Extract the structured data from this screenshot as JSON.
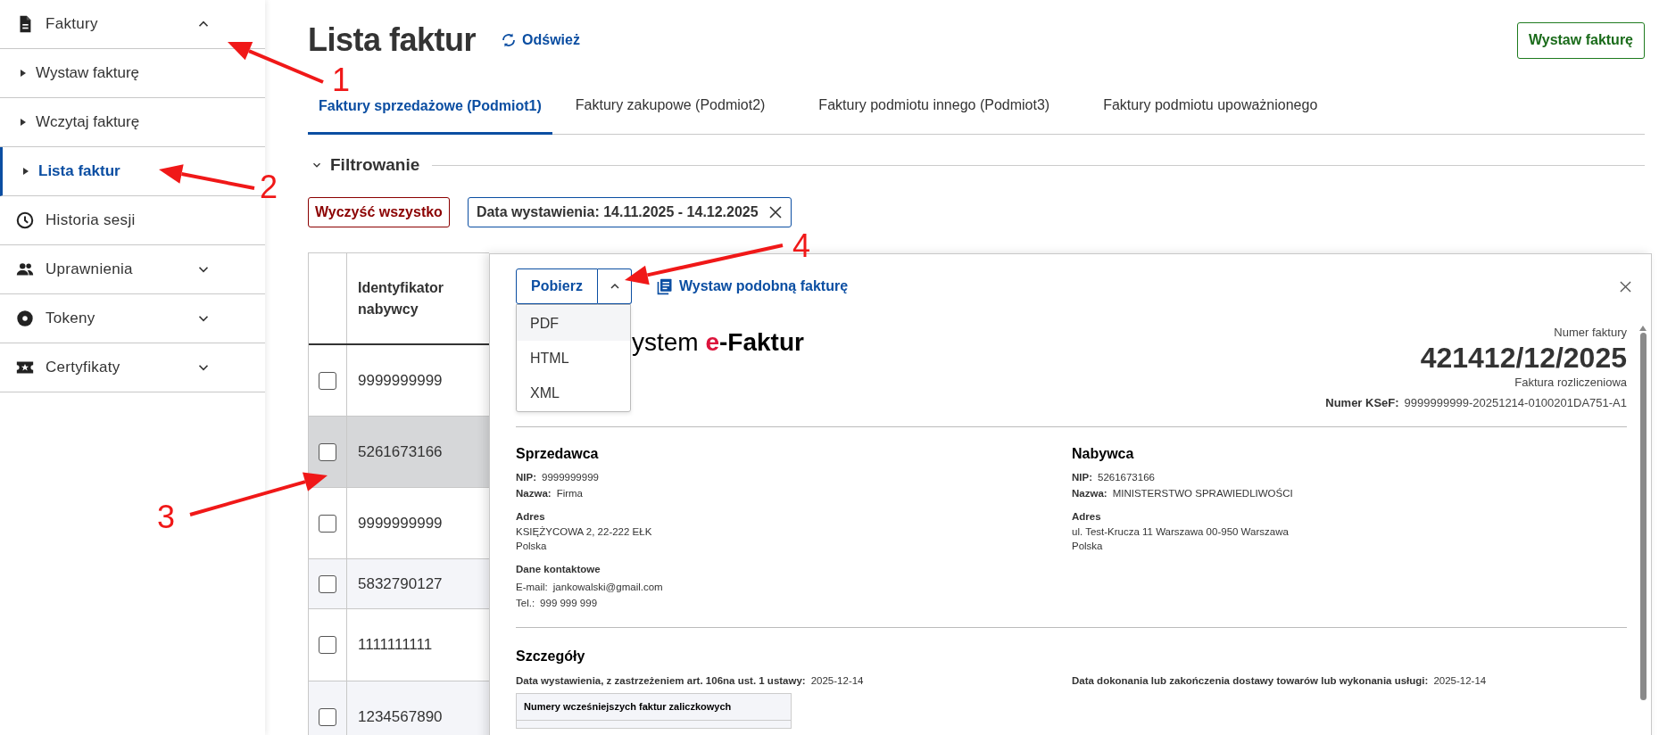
{
  "sidebar": {
    "items": [
      {
        "kind": "group",
        "label": "Faktury",
        "expanded": true,
        "children": [
          {
            "label": "Wystaw fakturę",
            "selected": false
          },
          {
            "label": "Wczytaj fakturę",
            "selected": false
          },
          {
            "label": "Lista faktur",
            "selected": true
          }
        ]
      },
      {
        "kind": "link",
        "label": "Historia sesji"
      },
      {
        "kind": "group",
        "label": "Uprawnienia",
        "expanded": false
      },
      {
        "kind": "group",
        "label": "Tokeny",
        "expanded": false
      },
      {
        "kind": "group",
        "label": "Certyfikaty",
        "expanded": false
      }
    ]
  },
  "header": {
    "title": "Lista faktur",
    "refresh": "Odśwież",
    "primary_button": "Wystaw fakturę"
  },
  "tabs": [
    {
      "label": "Faktury sprzedażowe (Podmiot1)",
      "selected": true
    },
    {
      "label": "Faktury zakupowe (Podmiot2)",
      "selected": false
    },
    {
      "label": "Faktury podmiotu innego (Podmiot3)",
      "selected": false
    },
    {
      "label": "Faktury podmiotu upoważnionego",
      "selected": false
    }
  ],
  "filter": {
    "title": "Filtrowanie",
    "expanded": true,
    "clear_button": "Wyczyść wszystko",
    "chips": [
      "Data wystawienia: 14.11.2025 - 14.12.2025"
    ]
  },
  "table": {
    "columns": [
      "Identyfikator nabywcy"
    ],
    "rows": [
      {
        "id": "9999999999",
        "selected": false,
        "checked": false
      },
      {
        "id": "5261673166",
        "selected": true,
        "checked": false
      },
      {
        "id": "9999999999",
        "selected": false,
        "checked": false
      },
      {
        "id": "5832790127",
        "selected": false,
        "checked": false
      },
      {
        "id": "1111111111",
        "selected": false,
        "checked": false
      },
      {
        "id": "1234567890",
        "selected": false,
        "checked": false
      }
    ]
  },
  "panel": {
    "download_button": "Pobierz",
    "menu_expanded": true,
    "menu": [
      {
        "label": "PDF",
        "selected": true
      },
      {
        "label": "HTML",
        "selected": false
      },
      {
        "label": "XML",
        "selected": false
      }
    ],
    "similar_link": "Wystaw podobną fakturę",
    "logo": {
      "prefix": "ystem ",
      "accent": "e",
      "suffix": "-Faktur"
    },
    "invoice": {
      "number_label": "Numer faktury",
      "number": "421412/12/2025",
      "type": "Faktura rozliczeniowa",
      "ksef_label": "Numer KSeF:",
      "ksef_value": "9999999999-20251214-0100201DA751-A1"
    },
    "parties": [
      {
        "title": "Sprzedawca",
        "fields": [
          {
            "label": "NIP:",
            "value": "9999999999"
          },
          {
            "label": "Nazwa:",
            "value": "Firma"
          }
        ],
        "address_title": "Adres",
        "address": [
          "KSIĘŻYCOWA 2, 22-222 EŁK",
          "Polska"
        ],
        "contact_title": "Dane kontaktowe",
        "contact": [
          {
            "label": "E-mail:",
            "value": "jankowalski@gmail.com"
          },
          {
            "label": "Tel.:",
            "value": "999 999 999"
          }
        ]
      },
      {
        "title": "Nabywca",
        "fields": [
          {
            "label": "NIP:",
            "value": "5261673166"
          },
          {
            "label": "Nazwa:",
            "value": "MINISTERSTWO SPRAWIEDLIWOŚCI"
          }
        ],
        "address_title": "Adres",
        "address": [
          "ul. Test-Krucza 11 Warszawa 00-950 Warszawa",
          "Polska"
        ]
      }
    ],
    "details": {
      "title": "Szczegóły",
      "fields": [
        {
          "label": "Data wystawienia, z zastrzeżeniem art. 106na ust. 1 ustawy:",
          "value": "2025-12-14"
        },
        {
          "label": "Data dokonania lub zakończenia dostawy towarów lub wykonania usługi:",
          "value": "2025-12-14"
        }
      ],
      "table_header": "Numery wcześniejszych faktur zaliczkowych"
    }
  },
  "annotations": [
    {
      "label": "1"
    },
    {
      "label": "2"
    },
    {
      "label": "3"
    },
    {
      "label": "4"
    }
  ]
}
